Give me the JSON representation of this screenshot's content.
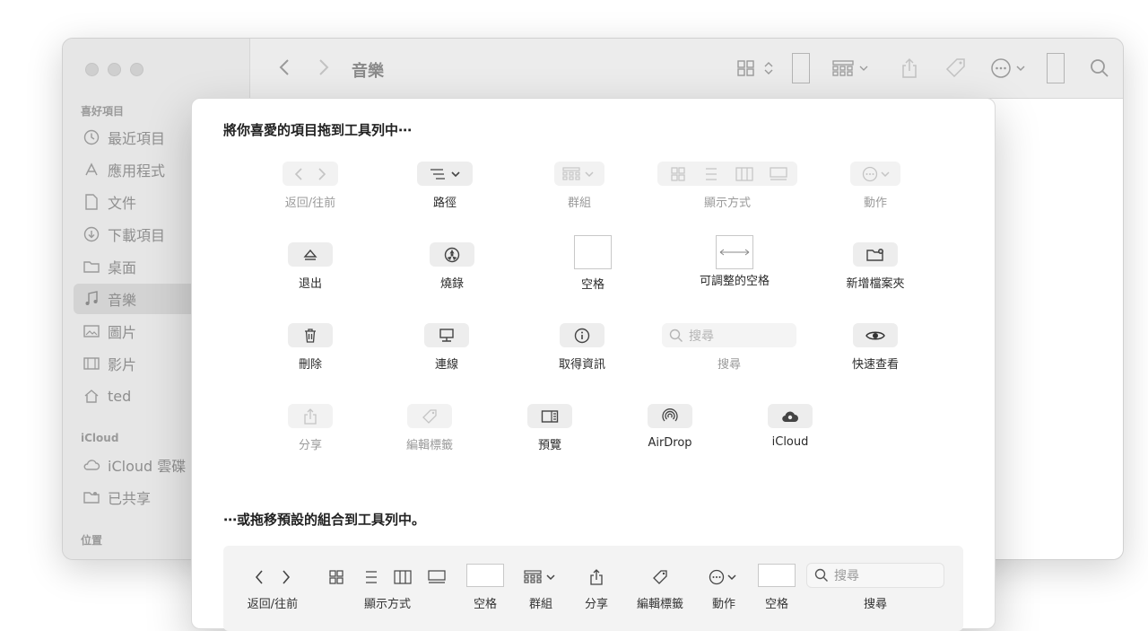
{
  "window": {
    "title": "音樂",
    "sidebar": {
      "sections": [
        {
          "header": "喜好項目",
          "items": [
            {
              "label": "最近項目",
              "icon": "clock-icon"
            },
            {
              "label": "應用程式",
              "icon": "apps-icon"
            },
            {
              "label": "文件",
              "icon": "document-icon"
            },
            {
              "label": "下載項目",
              "icon": "download-icon"
            },
            {
              "label": "桌面",
              "icon": "folder-icon"
            },
            {
              "label": "音樂",
              "icon": "music-icon",
              "selected": true
            },
            {
              "label": "圖片",
              "icon": "photo-icon"
            },
            {
              "label": "影片",
              "icon": "film-icon"
            },
            {
              "label": "ted",
              "icon": "home-icon"
            }
          ]
        },
        {
          "header": "iCloud",
          "items": [
            {
              "label": "iCloud 雲碟",
              "icon": "cloud-icon"
            },
            {
              "label": "已共享",
              "icon": "shared-folder-icon"
            }
          ]
        },
        {
          "header": "位置",
          "items": []
        }
      ]
    }
  },
  "customize": {
    "heading": "將你喜愛的項目拖到工具列中⋯",
    "items": [
      {
        "label": "返回/往前",
        "icon": "back-forward-icon",
        "enabled": false
      },
      {
        "label": "路徑",
        "icon": "path-icon",
        "enabled": true
      },
      {
        "label": "群組",
        "icon": "group-icon",
        "enabled": false
      },
      {
        "label": "顯示方式",
        "icon": "view-mode-icon",
        "enabled": false
      },
      {
        "label": "動作",
        "icon": "action-icon",
        "enabled": false
      },
      {
        "label": "退出",
        "icon": "eject-icon",
        "enabled": true
      },
      {
        "label": "燒錄",
        "icon": "burn-icon",
        "enabled": true
      },
      {
        "label": "空格",
        "icon": "space-icon",
        "enabled": true
      },
      {
        "label": "可調整的空格",
        "icon": "flexible-space-icon",
        "enabled": true
      },
      {
        "label": "新增檔案夾",
        "icon": "new-folder-icon",
        "enabled": true
      },
      {
        "label": "刪除",
        "icon": "trash-icon",
        "enabled": true
      },
      {
        "label": "連線",
        "icon": "connect-icon",
        "enabled": true
      },
      {
        "label": "取得資訊",
        "icon": "info-icon",
        "enabled": true
      },
      {
        "label": "搜尋",
        "icon": "search-icon",
        "enabled": false,
        "placeholder": "搜尋"
      },
      {
        "label": "快速查看",
        "icon": "eye-icon",
        "enabled": true
      },
      {
        "label": "分享",
        "icon": "share-icon",
        "enabled": false
      },
      {
        "label": "編輯標籤",
        "icon": "tag-icon",
        "enabled": false
      },
      {
        "label": "預覽",
        "icon": "preview-icon",
        "enabled": true
      },
      {
        "label": "AirDrop",
        "icon": "airdrop-icon",
        "enabled": true
      },
      {
        "label": "iCloud",
        "icon": "icloud-icon",
        "enabled": true
      }
    ],
    "default_heading": "⋯或拖移預設的組合到工具列中。",
    "default_set": [
      {
        "label": "返回/往前"
      },
      {
        "label": "顯示方式"
      },
      {
        "label": "空格"
      },
      {
        "label": "群組"
      },
      {
        "label": "分享"
      },
      {
        "label": "編輯標籤"
      },
      {
        "label": "動作"
      },
      {
        "label": "空格"
      },
      {
        "label": "搜尋"
      }
    ],
    "default_search_placeholder": "搜尋"
  }
}
